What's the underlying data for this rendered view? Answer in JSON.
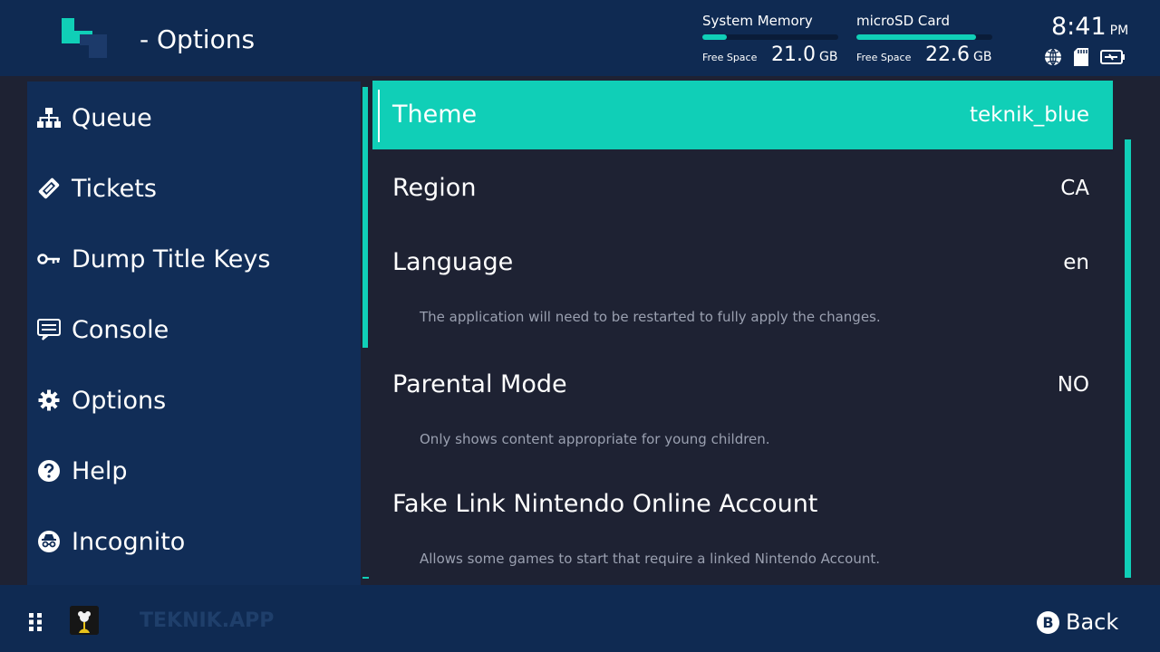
{
  "header": {
    "title": "- Options",
    "system_memory": {
      "label": "System Memory",
      "free_label": "Free Space",
      "amount": "21.0",
      "unit": "GB",
      "used_fraction": 0.18
    },
    "sd_card": {
      "label": "microSD Card",
      "free_label": "Free Space",
      "amount": "22.6",
      "unit": "GB",
      "used_fraction": 0.88
    },
    "time": "8:41",
    "ampm": "PM",
    "status_icons": [
      "globe-icon",
      "sd-card-icon",
      "battery-charging-icon"
    ]
  },
  "sidebar": {
    "items": [
      {
        "label": "Queue",
        "icon": "sitemap-icon"
      },
      {
        "label": "Tickets",
        "icon": "ticket-icon"
      },
      {
        "label": "Dump Title Keys",
        "icon": "key-icon"
      },
      {
        "label": "Console",
        "icon": "console-icon"
      },
      {
        "label": "Options",
        "icon": "gear-icon"
      },
      {
        "label": "Help",
        "icon": "help-icon"
      },
      {
        "label": "Incognito",
        "icon": "incognito-icon"
      }
    ]
  },
  "options": [
    {
      "name": "Theme",
      "value": "teknik_blue",
      "selected": true
    },
    {
      "name": "Region",
      "value": "CA"
    },
    {
      "name": "Language",
      "value": "en",
      "description": "The application will need to be restarted to fully apply the changes."
    },
    {
      "name": "Parental Mode",
      "value": "NO",
      "description": "Only shows content appropriate for young children."
    },
    {
      "name": "Fake Link Nintendo Online Account",
      "value": "",
      "description": "Allows some games to start that require a linked Nintendo Account."
    }
  ],
  "footer": {
    "app_name": "TEKNIK.APP",
    "back_button": "B",
    "back_label": "Back"
  },
  "colors": {
    "accent": "#10cfb7",
    "header_bg": "#0f2a52",
    "content_bg": "#1e2233",
    "description": "#9aa0b0"
  }
}
